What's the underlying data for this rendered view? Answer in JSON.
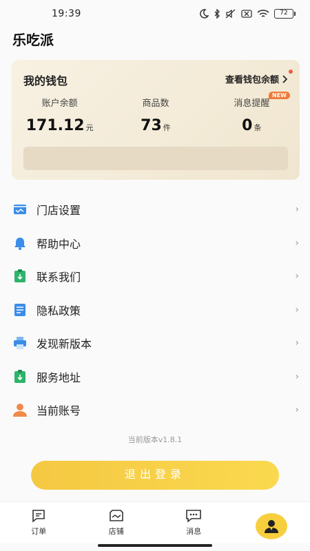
{
  "status": {
    "time": "19:39",
    "battery": "72"
  },
  "app_title": "乐吃派",
  "wallet": {
    "title": "我的钱包",
    "link_label": "查看钱包余额",
    "stats": [
      {
        "label": "账户余额",
        "value": "171.12",
        "unit": "元"
      },
      {
        "label": "商品数",
        "value": "73",
        "unit": "件"
      },
      {
        "label": "消息提醒",
        "value": "0",
        "unit": "条"
      }
    ],
    "new_badge": "NEW"
  },
  "menu": [
    {
      "label": "门店设置",
      "icon": "store-icon"
    },
    {
      "label": "帮助中心",
      "icon": "bell-icon"
    },
    {
      "label": "联系我们",
      "icon": "contact-icon"
    },
    {
      "label": "隐私政策",
      "icon": "document-icon"
    },
    {
      "label": "发现新版本",
      "icon": "printer-icon"
    },
    {
      "label": "服务地址",
      "icon": "address-icon"
    },
    {
      "label": "当前账号",
      "icon": "user-icon"
    }
  ],
  "version": "当前版本v1.8.1",
  "logout_label": "退出登录",
  "tabs": [
    {
      "label": "订单",
      "icon": "order-icon"
    },
    {
      "label": "店铺",
      "icon": "shop-icon"
    },
    {
      "label": "消息",
      "icon": "message-icon"
    }
  ],
  "colors": {
    "accent": "#f7cf3e",
    "badge": "#f07a3a",
    "wallet_bg": "#f4ebd9"
  }
}
